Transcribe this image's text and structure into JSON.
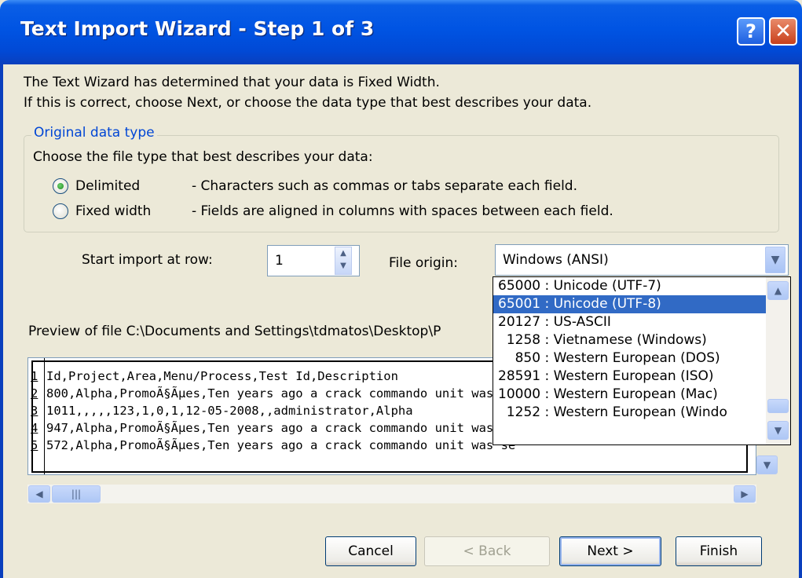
{
  "window": {
    "title": "Text Import Wizard - Step 1 of 3",
    "help_label": "?",
    "close_label": "✕"
  },
  "intro": {
    "line1": "The Text Wizard has determined that your data is Fixed Width.",
    "line2": "If this is correct, choose Next, or choose the data type that best describes your data."
  },
  "original_data_type": {
    "legend": "Original data type",
    "prompt": "Choose the file type that best describes your data:",
    "options": [
      {
        "label": "Delimited",
        "description": "- Characters such as commas or tabs separate each field.",
        "selected": true
      },
      {
        "label": "Fixed width",
        "description": "- Fields are aligned in columns with spaces between each field.",
        "selected": false
      }
    ]
  },
  "start_row": {
    "label": "Start import at row:",
    "value": "1"
  },
  "file_origin": {
    "label": "File origin:",
    "value": "Windows (ANSI)",
    "options": [
      "65000 : Unicode (UTF-7)",
      "65001 : Unicode (UTF-8)",
      "20127 : US-ASCII",
      "  1258 : Vietnamese (Windows)",
      "    850 : Western European (DOS)",
      "28591 : Western European (ISO)",
      "10000 : Western European (Mac)",
      "  1252 : Western European (Windo"
    ],
    "selected_index": 1
  },
  "preview": {
    "label": "Preview of file C:\\Documents and Settings\\tdmatos\\Desktop\\P",
    "rows": [
      {
        "num": "1",
        "text": "Id,Project,Area,Menu/Process,Test Id,Description"
      },
      {
        "num": "2",
        "text": "800,Alpha,PromoÃ§Ãµes,Ten years ago a crack commando unit was se"
      },
      {
        "num": "3",
        "text": "1011,,,,,123,1,0,1,12-05-2008,,administrator,Alpha"
      },
      {
        "num": "4",
        "text": "947,Alpha,PromoÃ§Ãµes,Ten years ago a crack commando unit was se"
      },
      {
        "num": "5",
        "text": "572,Alpha,PromoÃ§Ãµes,Ten years ago a crack commando unit was se"
      }
    ]
  },
  "buttons": {
    "cancel": "Cancel",
    "back": "< Back",
    "next": "Next >",
    "finish": "Finish"
  }
}
